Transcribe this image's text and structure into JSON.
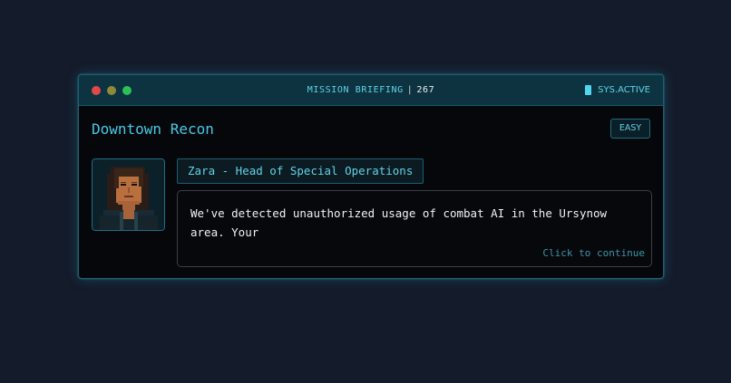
{
  "window": {
    "title": "MISSION BRIEFING",
    "separator": "|",
    "mission_number": "267",
    "status_label": "SYS.ACTIVE"
  },
  "mission": {
    "name": "Downtown Recon",
    "difficulty": "EASY"
  },
  "speaker": {
    "name": "Zara - Head of Special Operations",
    "avatar_icon": "pixel-portrait-woman"
  },
  "dialog": {
    "text": "We've detected unauthorized usage of combat AI in the Ursynow area. Your",
    "continue_label": "Click to continue"
  },
  "colors": {
    "accent": "#49c9e6",
    "background": "#141b2a",
    "panel": "#05070b",
    "titlebar": "#0e3340"
  }
}
